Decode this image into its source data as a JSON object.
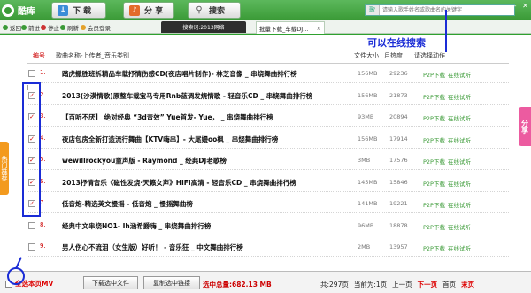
{
  "topbar": {
    "logo_text": "酷库",
    "nav": [
      {
        "label": "下 载",
        "icon": "download-icon"
      },
      {
        "label": "分 享",
        "icon": "share-icon"
      },
      {
        "label": "搜索",
        "icon": "search-icon"
      }
    ],
    "search_placeholder": "请输入歌手姓名或歌曲名的关键字",
    "search_type": "歌"
  },
  "subbar": {
    "items": [
      "返回",
      "前进",
      "停止",
      "刷新",
      "会员登录"
    ],
    "tab_search_word": "搜索词:2013网络",
    "tab_batch": "批量下载_车载DJ..."
  },
  "annotation": "可以在线搜索",
  "side": {
    "left_tab": "热门推荐",
    "right_tab": "分享"
  },
  "table": {
    "headers": {
      "index": "编号",
      "title": "歌曲名称-上传者_音乐类别",
      "size": "文件大小",
      "plays": "月热度",
      "actions": "请选择动作"
    },
    "rows": [
      {
        "index": "1.",
        "checked": false,
        "title": "踏虎撒胜班拆精品车载抒情伤感CD(夜店唱片制作)- 林芝音像 _ 串烧舞曲排行榜",
        "size": "156MB",
        "plays": "29236",
        "p2p": "P2P下载",
        "online": "在线试听"
      },
      {
        "index": "2.",
        "checked": true,
        "title": "2013(沙漠情歌)原整车载宝马专用Rnb蓝调发烧情歌 - 轻音乐CD _ 串烧舞曲排行榜",
        "size": "156MB",
        "plays": "21873",
        "p2p": "P2P下载",
        "online": "在线试听"
      },
      {
        "index": "3.",
        "checked": true,
        "title": "【百听不厌】 绝对经典 “3d音效” Yue首发- Yue， _ 串烧舞曲排行榜",
        "size": "93MB",
        "plays": "20894",
        "p2p": "P2P下载",
        "online": "在线试听"
      },
      {
        "index": "4.",
        "checked": true,
        "title": "夜店包房全新打造流行舞曲【KTV嗨串】- 大尾嫚oo枫 _ 串烧舞曲排行榜",
        "size": "156MB",
        "plays": "17914",
        "p2p": "P2P下载",
        "online": "在线试听"
      },
      {
        "index": "5.",
        "checked": true,
        "title": "wewillrockyou童声版 - Raymond _ 经典DJ老歌榜",
        "size": "3MB",
        "plays": "17576",
        "p2p": "P2P下载",
        "online": "在线试听"
      },
      {
        "index": "6.",
        "checked": true,
        "title": "2013抒情音乐《磁性发烧·天籁女声》HIFI高清 - 轻音乐CD _ 串烧舞曲排行榜",
        "size": "145MB",
        "plays": "15846",
        "p2p": "P2P下载",
        "online": "在线试听"
      },
      {
        "index": "7.",
        "checked": true,
        "title": "低音炮-精选英文慢摇 - 低音炮 _ 慢摇舞曲榜",
        "size": "141MB",
        "plays": "19221",
        "p2p": "P2P下载",
        "online": "在线试听"
      },
      {
        "index": "8.",
        "checked": false,
        "title": "经典中文串烧NO1- Ih涵希爵嗨 _ 串烧舞曲排行榜",
        "size": "96MB",
        "plays": "18878",
        "p2p": "P2P下载",
        "online": "在线试听"
      },
      {
        "index": "9.",
        "checked": false,
        "title": "男人伤心不流泪（女生版）好听！ - 音乐狂 _ 中文舞曲排行榜",
        "size": "2MB",
        "plays": "13957",
        "p2p": "P2P下载",
        "online": "在线试听"
      }
    ]
  },
  "footer": {
    "select_all": "全选本页MV",
    "btn_download_selected": "下载选中文件",
    "btn_copy_links": "复制选中链接",
    "total_size": "选中总量:682.13 MB",
    "pager": [
      "共:297页",
      "当前为:1页",
      "上一页",
      "下一页",
      "首页",
      "末页"
    ]
  },
  "colors": {
    "green": "#3a9a36",
    "annotation_blue": "#1a2cd6",
    "red": "#d00"
  }
}
